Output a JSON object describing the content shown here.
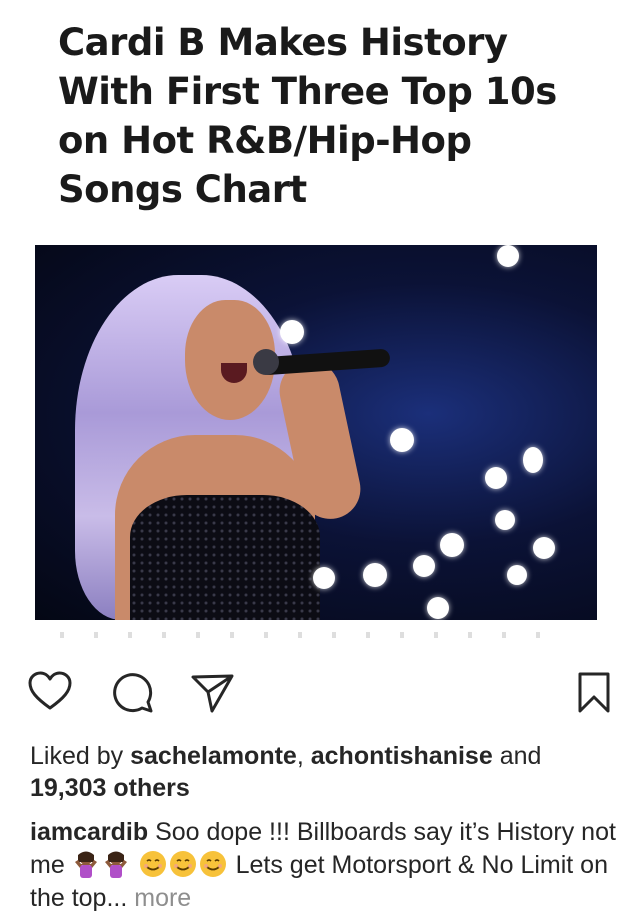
{
  "article": {
    "headline": "Cardi B Makes History With First Three Top 10s on Hot R&B/Hip-Hop Songs Chart"
  },
  "likes": {
    "prefix": "Liked by",
    "user1": "sachelamonte",
    "sep": ",",
    "user2": "achontishanise",
    "and": "and",
    "others": "19,303 others"
  },
  "caption": {
    "username": "iamcardib",
    "text_part1": "Soo dope !!! Billboards say it’s History not me",
    "text_part2": "Lets get Motorsport & No Limit on the top...",
    "more": "more",
    "emojis": [
      "woman-shrugging-emoji",
      "woman-shrugging-emoji",
      "smiling-face-emoji",
      "smiling-face-emoji",
      "smiling-face-emoji"
    ]
  },
  "colors": {
    "text": "#262626",
    "muted": "#8e8e8e",
    "icon": "#262626"
  }
}
